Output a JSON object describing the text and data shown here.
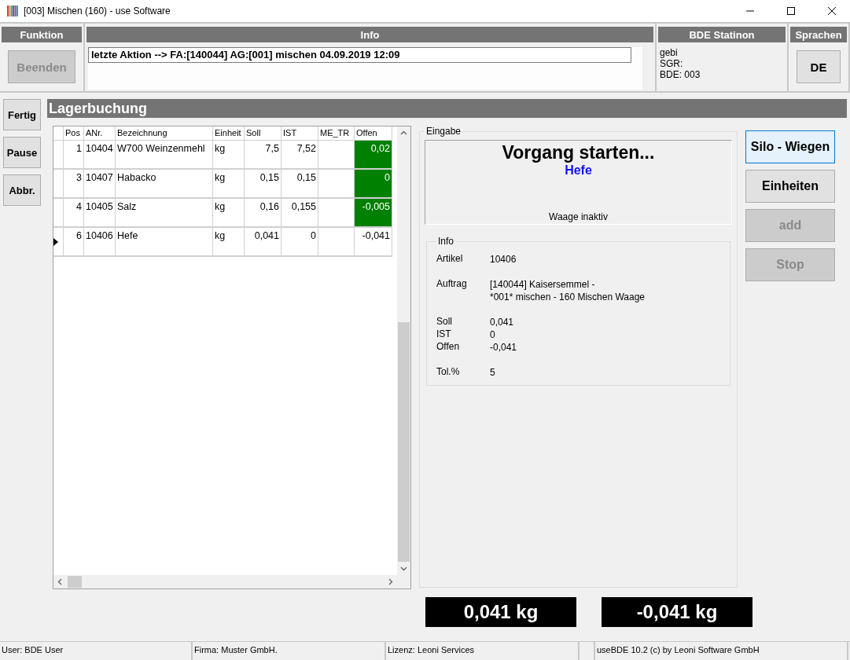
{
  "window": {
    "title": "[003] Mischen (160) - use Software"
  },
  "header": {
    "funktion": {
      "title": "Funktion",
      "button": {
        "label": "Beenden",
        "disabled": true
      }
    },
    "info": {
      "title": "Info",
      "value": "letzte Aktion --> FA:[140044] AG:[001] mischen 04.09.2019 12:09"
    },
    "station": {
      "title": "BDE Statinon",
      "lines": [
        "gebi",
        "SGR:",
        "BDE: 003"
      ]
    },
    "sprachen": {
      "title": "Sprachen",
      "button": {
        "label": "DE",
        "disabled": false
      }
    }
  },
  "side_buttons": [
    {
      "label": "Fertig"
    },
    {
      "label": "Pause"
    },
    {
      "label": "Abbr."
    }
  ],
  "section_title": "Lagerbuchung",
  "table": {
    "columns": [
      "Pos",
      "ANr.",
      "Bezeichnung",
      "Einheit",
      "Soll",
      "IST",
      "ME_TR",
      "Offen"
    ],
    "rows": [
      {
        "selected": false,
        "offen_ok": true,
        "cells": [
          "1",
          "10404",
          "W700 Weinzenmehl",
          "kg",
          "7,5",
          "7,52",
          "",
          "0,02"
        ]
      },
      {
        "selected": false,
        "offen_ok": true,
        "cells": [
          "3",
          "10407",
          "Habacko",
          "kg",
          "0,15",
          "0,15",
          "",
          "0"
        ]
      },
      {
        "selected": false,
        "offen_ok": true,
        "cells": [
          "4",
          "10405",
          "Salz",
          "kg",
          "0,16",
          "0,155",
          "",
          "-0,005"
        ]
      },
      {
        "selected": true,
        "offen_ok": false,
        "cells": [
          "6",
          "10406",
          "Hefe",
          "kg",
          "0,041",
          "0",
          "",
          "-0,041"
        ]
      }
    ]
  },
  "eingabe": {
    "title": "Eingabe",
    "heading": "Vorgang starten...",
    "article": "Hefe",
    "status": "Waage inaktiv"
  },
  "info_panel": {
    "title": "Info",
    "groups": [
      [
        {
          "label": "Artikel",
          "value": "10406"
        }
      ],
      [
        {
          "label": "Auftrag",
          "value": "[140044] Kaisersemmel -\n*001* mischen - 160 Mischen Waage"
        }
      ],
      [
        {
          "label": "Soll",
          "value": "0,041"
        },
        {
          "label": "IST",
          "value": "0"
        },
        {
          "label": "Offen",
          "value": "-0,041"
        }
      ],
      [
        {
          "label": "Tol.%",
          "value": "5"
        }
      ]
    ]
  },
  "action_buttons": [
    {
      "label": "Silo - Wiegen",
      "disabled": false,
      "focused": true
    },
    {
      "label": "Einheiten",
      "disabled": false,
      "focused": false
    },
    {
      "label": "add",
      "disabled": true,
      "focused": false
    },
    {
      "label": "Stop",
      "disabled": true,
      "focused": false
    }
  ],
  "readouts": [
    "0,041 kg",
    "-0,041 kg"
  ],
  "status_bar": [
    "User: BDE User",
    "Firma: Muster GmbH.",
    "Lizenz: Leoni Services",
    "useBDE 10.2 (c) by Leoni Software GmbH"
  ]
}
